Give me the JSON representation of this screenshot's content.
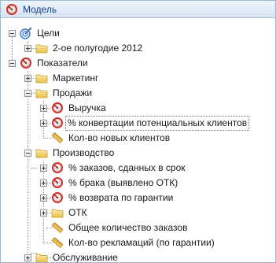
{
  "panel": {
    "title": "Модель",
    "title_icon": "gauge-icon"
  },
  "tree": {
    "goals": {
      "label": "Цели",
      "children": {
        "period": {
          "label": "2-ое полугодие 2012"
        }
      }
    },
    "indicators": {
      "label": "Показатели",
      "children": {
        "marketing": {
          "label": "Маркетинг"
        },
        "sales": {
          "label": "Продажи",
          "children": {
            "revenue": {
              "label": "Выручка"
            },
            "conversion": {
              "label": "% конвертации потенциальных клиентов"
            },
            "new_clients": {
              "label": "Кол-во новых клиентов"
            }
          }
        },
        "production": {
          "label": "Производство",
          "children": {
            "orders_on_time": {
              "label": "% заказов, сданных в срок"
            },
            "defects": {
              "label": "% брака (выявлено ОТК)"
            },
            "warranty_returns": {
              "label": "% возврата по гарантии"
            },
            "qc_folder": {
              "label": "ОТК"
            },
            "total_orders": {
              "label": "Общее количество заказов"
            },
            "warranty_claims": {
              "label": "Кол-во рекламаций (по гарантии)"
            }
          }
        },
        "service": {
          "label": "Обслуживание"
        }
      }
    }
  },
  "colors": {
    "folder": "#f5d86a",
    "gauge_red": "#d4302b",
    "ruler": "#d9a640",
    "goal_blue": "#3a78c8"
  }
}
